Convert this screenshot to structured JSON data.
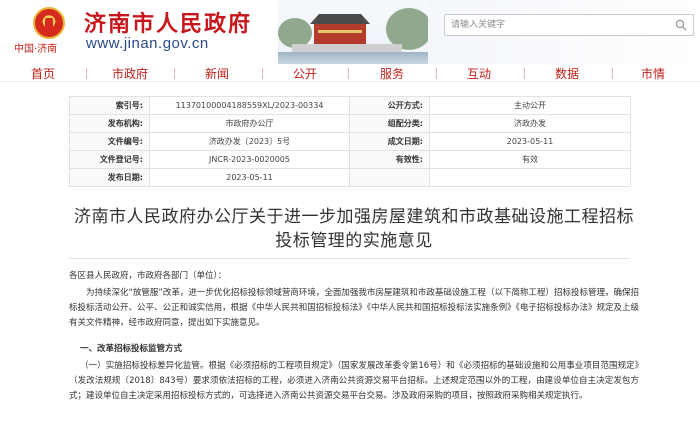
{
  "header": {
    "site_title": "济南市人民政府",
    "brand_sub": "中国·济南",
    "url": "www.jinan.gov.cn",
    "search_placeholder": "请输入关键字"
  },
  "nav": {
    "items": [
      "首页",
      "市政府",
      "新闻",
      "公开",
      "服务",
      "互动",
      "数据",
      "市情"
    ]
  },
  "info_table": {
    "rows": [
      [
        "索引号:",
        "11370100004188559XL/2023-00334",
        "公开方式:",
        "主动公开"
      ],
      [
        "发布机构:",
        "市政府办公厅",
        "组配分类:",
        "济政办发"
      ],
      [
        "文件编号:",
        "济政办发〔2023〕5号",
        "成文日期:",
        "2023-05-11"
      ],
      [
        "文件登记号:",
        "JNCR-2023-0020005",
        "有效性:",
        "有效"
      ],
      [
        "发布日期:",
        "2023-05-11",
        "",
        ""
      ]
    ]
  },
  "article": {
    "title": "济南市人民政府办公厅关于进一步加强房屋建筑和市政基础设施工程招标投标管理的实施意见",
    "salutation": "各区县人民政府，市政府各部门（单位）：",
    "para1": "为持续深化“放管服”改革，进一步优化招标投标领域营商环境，全面加强我市房屋建筑和市政基础设施工程（以下简称工程）招标投标管理，确保招标投标活动公开、公平、公正和诚实信用，根据《中华人民共和国招标投标法》《中华人民共和国招标投标法实施条例》《电子招标投标办法》规定及上级有关文件精神，经市政府同意，提出如下实施意见。",
    "heading": "一、改革招标投标监管方式",
    "para2": "（一）实施招标投标差异化监管。根据《必须招标的工程项目规定》（国家发展改革委令第16号）和《必须招标的基础设施和公用事业项目范围规定》（发改法规规〔2018〕843号）要求须依法招标的工程，必须进入济南公共资源交易平台招标。上述规定范围以外的工程，由建设单位自主决定发包方式；建设单位自主决定采用招标投标方式的，可选择进入济南公共资源交易平台交易。涉及政府采购的项目，按照政府采购相关规定执行。"
  },
  "colors": {
    "brand_red": "#c8161d",
    "url_blue": "#2b4a8b"
  }
}
